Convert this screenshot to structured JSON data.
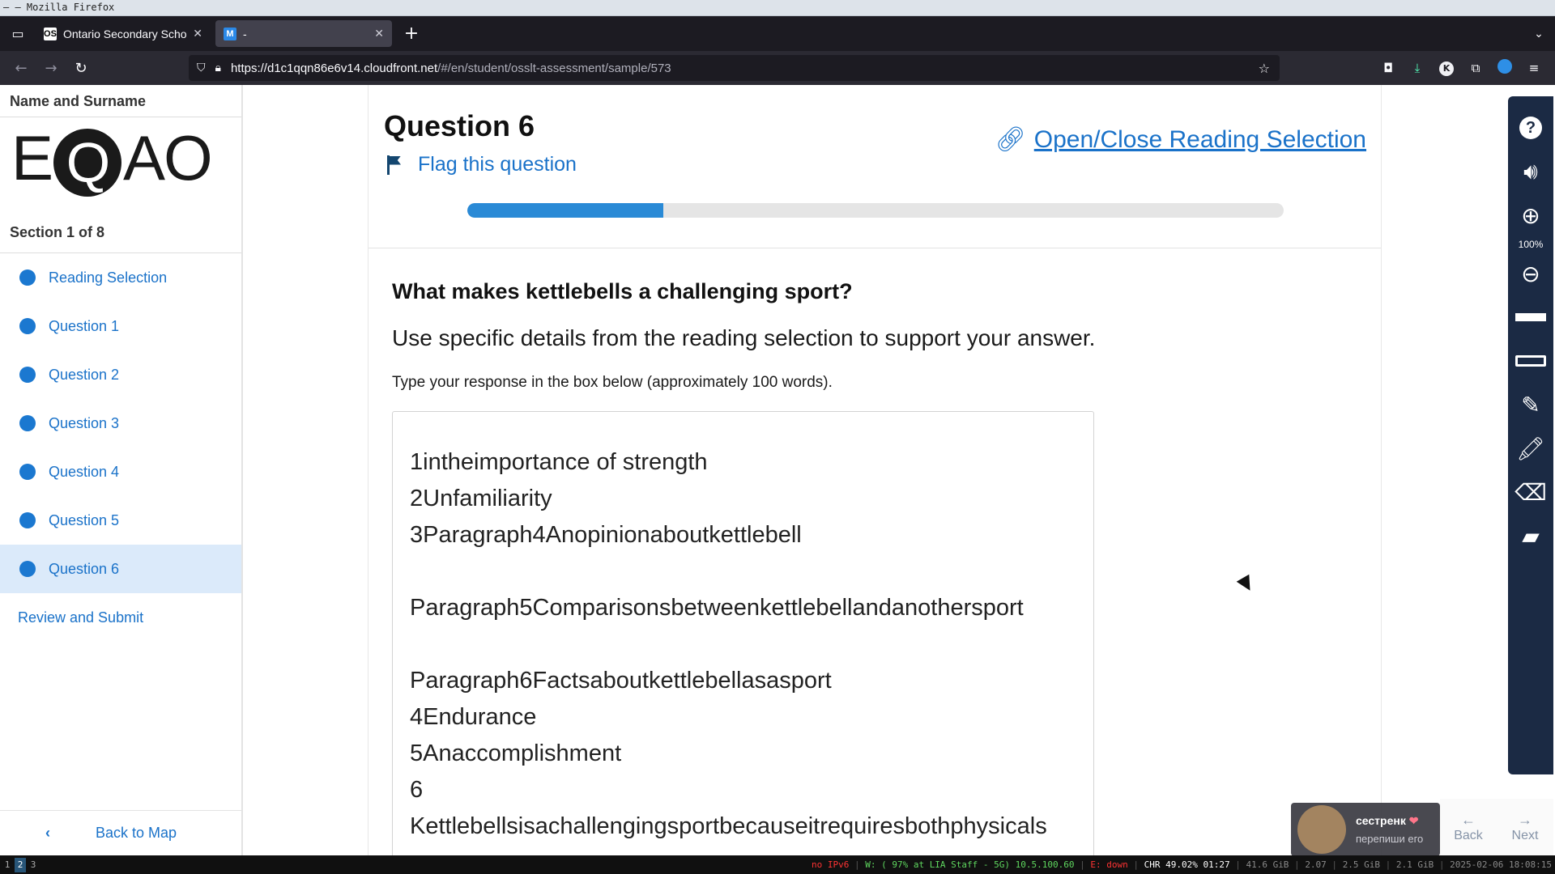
{
  "window": {
    "title": "– – Mozilla Firefox"
  },
  "browser": {
    "tabs": [
      {
        "label": "Ontario Secondary School",
        "favicon": "OS"
      },
      {
        "label": "-",
        "favicon": "M"
      }
    ],
    "url_host": "https://d1c1qqn86e6v14.cloudfront.net",
    "url_path": "/#/en/student/osslt-assessment/sample/573"
  },
  "sidebar": {
    "user_name": "Name and Surname",
    "logo": {
      "left": "E",
      "q": "Q",
      "right": "AO"
    },
    "section": "Section 1 of 8",
    "items": [
      {
        "label": "Reading Selection"
      },
      {
        "label": "Question 1"
      },
      {
        "label": "Question 2"
      },
      {
        "label": "Question 3"
      },
      {
        "label": "Question 4"
      },
      {
        "label": "Question 5"
      },
      {
        "label": "Question 6",
        "active": true
      }
    ],
    "review": "Review and Submit",
    "back": "Back to Map"
  },
  "question": {
    "title": "Question 6",
    "flag": "Flag this question",
    "open_close": "Open/Close Reading Selection",
    "progress": 0.24,
    "prompt": "What makes kettlebells a challenging sport?",
    "instruction": "Use specific details from the reading selection to support your answer.",
    "hint": "Type your response in the box below (approximately 100 words).",
    "answer": "1intheimportance of strength\n2Unfamiliarity\n3Paragraph4Anopinionaboutkettlebell\n\nParagraph5Comparisonsbetweenkettlebellandanothersport\n\nParagraph6Factsaboutkettlebellasasport\n4Endurance\n5Anaccomplishment\n6\nKettlebellsisachallengingsportbecauseitrequiresbothphysicals"
  },
  "tools": {
    "zoom": "100%"
  },
  "bottom_nav": {
    "back": "Back",
    "next": "Next"
  },
  "notification": {
    "name": "сестренк",
    "subtitle": "перепиши его"
  },
  "statusbar": {
    "workspaces": [
      "1",
      "2",
      "3"
    ],
    "ipv6": "no IPv6",
    "wifi": "W: ( 97% at LIA Staff - 5G) 10.5.100.60",
    "eth": "E: down",
    "chr": "CHR 49.02% 01:27",
    "load": "41.6 GiB",
    "load2": "2.07",
    "mem": "2.5 GiB",
    "mem2": "2.1 GiB",
    "clock": "2025-02-06 18:08:15"
  },
  "colors": {
    "accent": "#1a72c9",
    "progress": "#2a8ad6",
    "toolbar": "#1b2a44",
    "active_item": "#dbeafa"
  }
}
